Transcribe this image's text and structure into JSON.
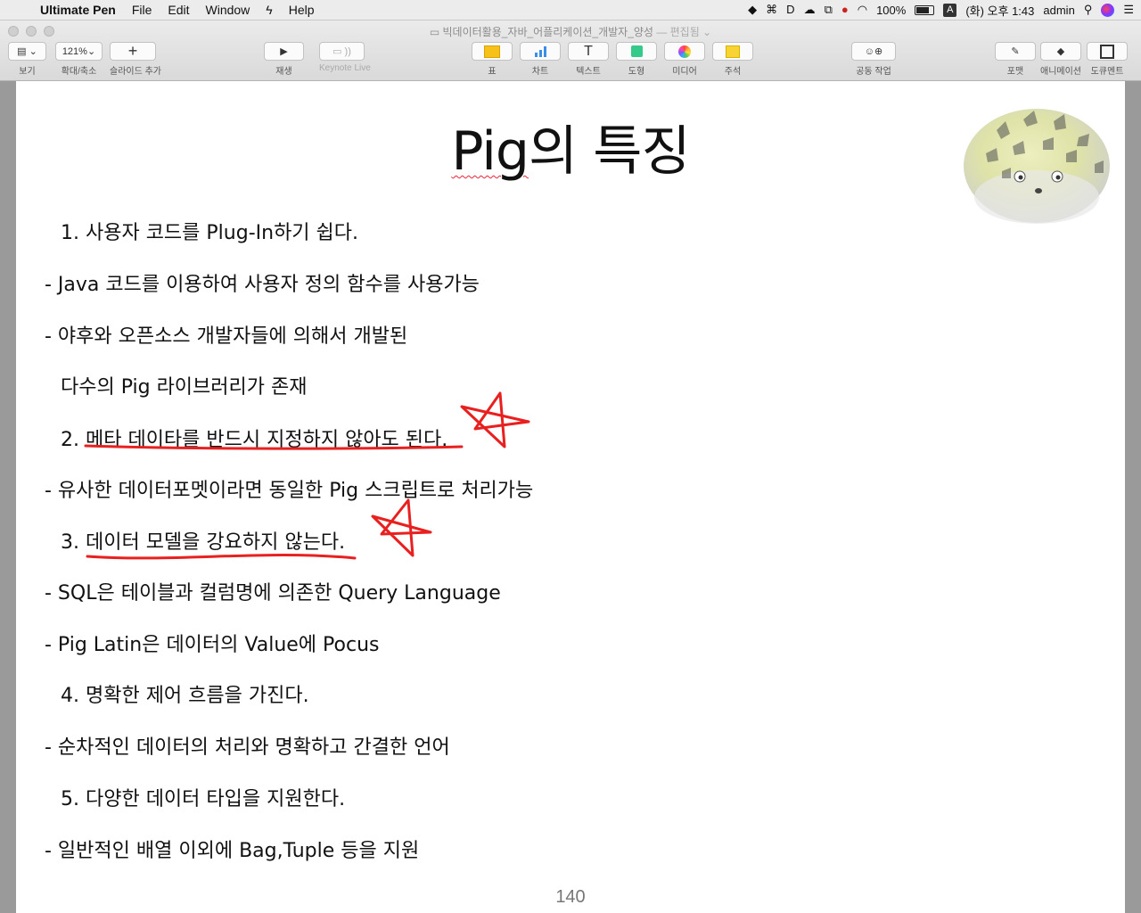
{
  "menubar": {
    "app_name": "Ultimate Pen",
    "menus": [
      "File",
      "Edit",
      "Window",
      "Help"
    ],
    "battery_percent": "100%",
    "input_source": "A",
    "clock": "(화) 오후 1:43",
    "user": "admin"
  },
  "window": {
    "title": "빅데이터활용_자바_어플리케이션_개발자_양성",
    "status": "— 편집됨 ⌄"
  },
  "toolbar": {
    "view_label": "보기",
    "zoom_value": "121%",
    "zoom_label": "확대/축소",
    "add_slide_label": "슬라이드 추가",
    "play_label": "재생",
    "keynote_live_label": "Keynote Live",
    "table_label": "표",
    "chart_label": "차트",
    "text_label": "텍스트",
    "shape_label": "도형",
    "media_label": "미디어",
    "comment_label": "주석",
    "collaborate_label": "공동 작업",
    "format_label": "포맷",
    "animate_label": "애니메이션",
    "document_label": "도큐멘트",
    "text_icon": "T"
  },
  "colors": {
    "annotation": "#e8201f",
    "slide_bg": "#ffffff",
    "spell_underline": "#e23333"
  },
  "slide": {
    "title_part1": "Pig",
    "title_part2": "의 특징",
    "lines": [
      {
        "text": "1.   사용자 코드를 Plug-In하기 쉽다."
      },
      {
        "text": "- Java 코드를 이용하여 사용자 정의 함수를 사용가능"
      },
      {
        "text": "- 야후와 오픈소스 개발자들에 의해서 개발된"
      },
      {
        "text": "다수의 Pig 라이브러리가 존재"
      },
      {
        "text": "2.  메타 데이타를 반드시 지정하지 않아도 된다."
      },
      {
        "text": "- 유사한 데이터포멧이라면 동일한 Pig 스크립트로 처리가능"
      },
      {
        "text": "3.  데이터 모델을 강요하지 않는다."
      },
      {
        "text": "- SQL은 테이블과 컬럼명에 의존한 Query Language"
      },
      {
        "text": "- Pig Latin은 데이터의 Value에 Pocus"
      },
      {
        "text": "4.  명확한 제어 흐름을 가진다."
      },
      {
        "text": "- 순차적인 데이터의 처리와 명확하고 간결한 언어"
      },
      {
        "text": "5.  다양한 데이터 타입을 지원한다."
      },
      {
        "text": "- 일반적인 배열 이외에 Bag,Tuple 등을 지원"
      }
    ],
    "page_number": "140"
  }
}
